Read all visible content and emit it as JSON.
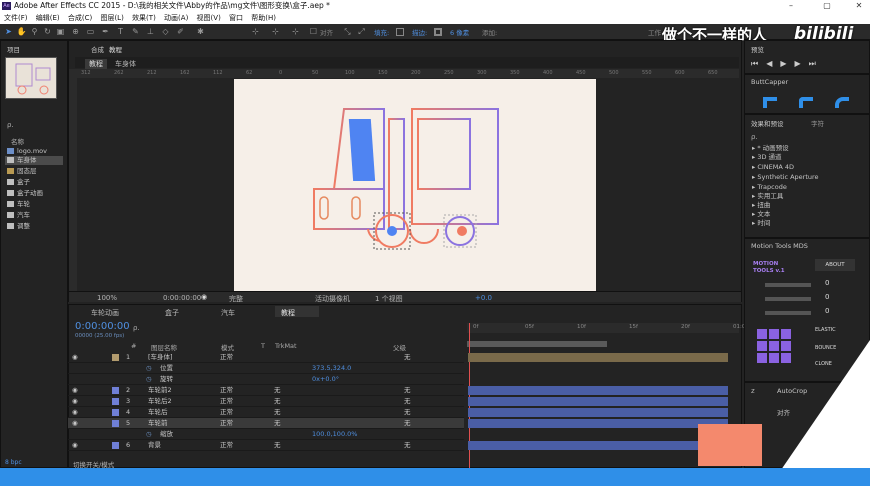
{
  "window": {
    "title": "Adobe After Effects CC 2015 - D:\\我的相关文件\\Abby的作品\\mg文件\\图形变换\\盒子.aep *",
    "app_badge": "Ae"
  },
  "menu": [
    "文件(F)",
    "编辑(E)",
    "合成(C)",
    "图层(L)",
    "效果(T)",
    "动画(A)",
    "视图(V)",
    "窗口",
    "帮助(H)"
  ],
  "toolbar": {
    "align_label": "对齐",
    "fill_label": "填充:",
    "stroke_label": "描边:",
    "stroke_value": "6 像素",
    "add_label": "添加:",
    "workspace_label": "工作"
  },
  "watermark": {
    "text": "做个不一样的人",
    "logo": "bilibili"
  },
  "project": {
    "title": "项目",
    "search_placeholder": "ρ.",
    "name_header": "名称",
    "items": [
      "logo.mov",
      "车身体",
      "固态层",
      "盒子",
      "盒子动画",
      "车轮",
      "汽车",
      "调整"
    ],
    "bpc": "8 bpc"
  },
  "comp_panel": {
    "title": "合成",
    "comp_name": "教程",
    "breadcrumb": [
      "教程",
      "车身体"
    ],
    "ruler_ticks": [
      "312",
      "262",
      "212",
      "162",
      "112",
      "62",
      "0",
      "50",
      "100",
      "150",
      "200",
      "250",
      "300",
      "350",
      "400",
      "450",
      "500",
      "550",
      "600",
      "650"
    ],
    "zoom": "100%",
    "timecode": "0:00:00:00",
    "resolution": "完整",
    "camera": "活动摄像机",
    "views": "1 个视图",
    "exposure": "+0.0"
  },
  "timeline": {
    "tabs": [
      "车轮动画",
      "盒子",
      "汽车",
      "教程"
    ],
    "timecode": "0:00:00:00",
    "fps": "00000 (25.00 fps)",
    "headers": {
      "num": "#",
      "name": "图层名称",
      "mode": "模式",
      "t": "T",
      "trkmat": "TrkMat",
      "parent": "父级"
    },
    "ruler": [
      "0f",
      "05f",
      "10f",
      "15f",
      "20f",
      "01:0"
    ],
    "layers": [
      {
        "num": "1",
        "name": "[车身体]",
        "mode": "正常",
        "trkmat": "",
        "parent": "无",
        "color": "#b29b6e"
      },
      {
        "num": "",
        "name": "位置",
        "mode": "",
        "trkmat": "",
        "parent": "",
        "value": "373.5,324.0",
        "color": ""
      },
      {
        "num": "",
        "name": "旋转",
        "mode": "",
        "trkmat": "",
        "parent": "",
        "value": "0x+0.0°",
        "color": ""
      },
      {
        "num": "2",
        "name": "车轮前2",
        "mode": "正常",
        "trkmat": "无",
        "parent": "无",
        "color": "#6f7fd6"
      },
      {
        "num": "3",
        "name": "车轮后2",
        "mode": "正常",
        "trkmat": "无",
        "parent": "无",
        "color": "#6f7fd6"
      },
      {
        "num": "4",
        "name": "车轮后",
        "mode": "正常",
        "trkmat": "无",
        "parent": "无",
        "color": "#6f7fd6"
      },
      {
        "num": "5",
        "name": "车轮前",
        "mode": "正常",
        "trkmat": "无",
        "parent": "无",
        "color": "#6f7fd6"
      },
      {
        "num": "",
        "name": "缩放",
        "mode": "",
        "trkmat": "",
        "parent": "",
        "value": "100.0,100.0%",
        "color": ""
      },
      {
        "num": "6",
        "name": "背景",
        "mode": "正常",
        "trkmat": "无",
        "parent": "无",
        "color": "#6f7fd6"
      }
    ],
    "footer_label": "切换开关/模式"
  },
  "preview": {
    "title": "预览"
  },
  "buttcapper": {
    "title": "ButtCapper"
  },
  "effects": {
    "tabs": [
      "效果和预设",
      "字符"
    ],
    "search_placeholder": "ρ.",
    "items": [
      "* 动画预设",
      "3D 通道",
      "CINEMA 4D",
      "Synthetic Aperture",
      "Trapcode",
      "实用工具",
      "扭曲",
      "文本",
      "时间"
    ]
  },
  "motion_tools": {
    "title": "Motion Tools MDS",
    "logo_line1": "MOTION",
    "logo_line2": "TOOLS v.1",
    "about": "ABOUT",
    "values": [
      "0",
      "0",
      "0"
    ],
    "buttons": [
      "ELASTIC",
      "BOUNCE",
      "CLONE"
    ]
  },
  "bottom_right": {
    "tabs": [
      "AutoCrop",
      "对齐"
    ],
    "z_label": "z"
  }
}
